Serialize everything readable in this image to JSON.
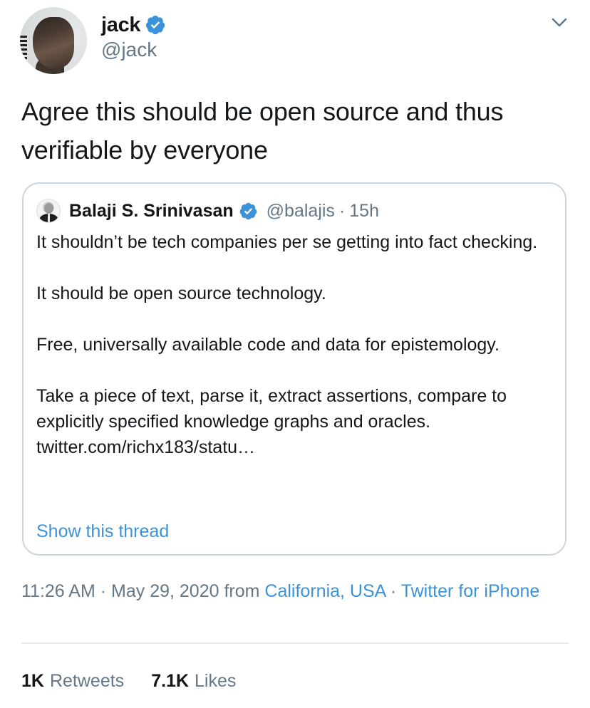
{
  "author": {
    "display_name": "jack",
    "handle": "@jack",
    "verified": true,
    "avatar_icon": "profile-photo"
  },
  "tweet": {
    "text": "Agree this should be open source and thus verifiable by everyone"
  },
  "quoted_tweet": {
    "display_name": "Balaji S. Srinivasan",
    "handle": "@balajis",
    "separator": "·",
    "time": "15h",
    "verified": true,
    "paragraphs": [
      "It shouldn’t be tech companies per se getting into fact checking.",
      "It should be open source technology.",
      "Free, universally available code and data for epistemology.",
      "Take a piece of text, parse it, extract assertions, compare to explicitly specified knowledge graphs and oracles. twitter.com/richx183/statu…"
    ],
    "show_thread_label": "Show this thread"
  },
  "meta": {
    "time": "11:26 AM",
    "separator": "·",
    "date": "May 29, 2020",
    "from_label": "from",
    "location": "California, USA",
    "source": "Twitter for iPhone"
  },
  "stats": {
    "retweets_count": "1K",
    "retweets_label": "Retweets",
    "likes_count": "7.1K",
    "likes_label": "Likes"
  },
  "colors": {
    "link": "#3b94d9",
    "verified": "#3b94d9",
    "secondary_text": "#657786",
    "primary_text": "#14171a",
    "border": "#ccd6dd"
  }
}
